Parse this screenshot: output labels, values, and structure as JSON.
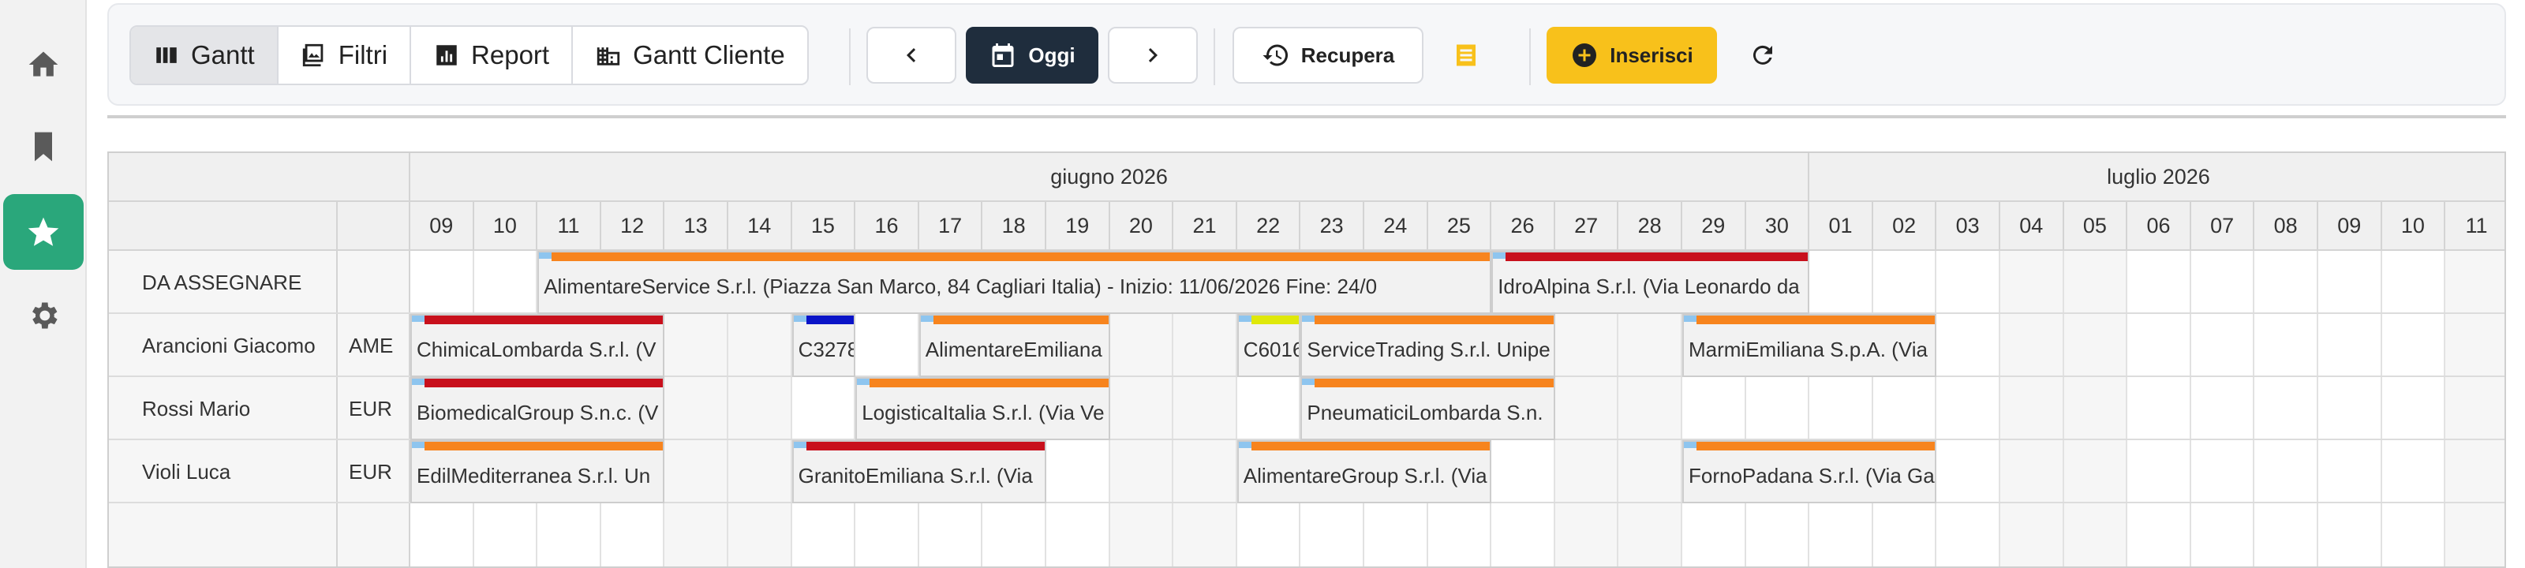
{
  "rail": {
    "items": [
      {
        "icon": "home-icon",
        "active": false
      },
      {
        "icon": "bookmark-icon",
        "active": false
      },
      {
        "icon": "star-icon",
        "active": true
      },
      {
        "icon": "gear-icon",
        "active": false
      }
    ]
  },
  "toolbar": {
    "views": [
      {
        "label": "Gantt",
        "icon": "columns-icon",
        "active": true
      },
      {
        "label": "Filtri",
        "icon": "image-filter-icon",
        "active": false
      },
      {
        "label": "Report",
        "icon": "chart-icon",
        "active": false
      },
      {
        "label": "Gantt Cliente",
        "icon": "building-icon",
        "active": false
      }
    ],
    "today_label": "Oggi",
    "recover_label": "Recupera",
    "insert_label": "Inserisci"
  },
  "colors": {
    "accent_green": "#2aa77b",
    "today_bg": "#1f2d3d",
    "insert_bg": "#f8c11b",
    "orange": "#f7841e",
    "red": "#c8101c",
    "blue": "#0a14c8",
    "yellow": "#dfe80a"
  },
  "gantt": {
    "months": [
      "giugno 2026",
      "luglio 2026"
    ],
    "days": [
      "09",
      "10",
      "11",
      "12",
      "13",
      "14",
      "15",
      "16",
      "17",
      "18",
      "19",
      "20",
      "21",
      "22",
      "23",
      "24",
      "25",
      "26",
      "27",
      "28",
      "29",
      "30",
      "01",
      "02",
      "03",
      "04",
      "05",
      "06",
      "07",
      "08",
      "09",
      "10",
      "11"
    ],
    "weekend_days": [
      4,
      5,
      11,
      12,
      18,
      19,
      25,
      26,
      32
    ],
    "rows": [
      {
        "name": "DA ASSEGNARE",
        "code": ""
      },
      {
        "name": "Arancioni Giacomo",
        "code": "AME"
      },
      {
        "name": "Rossi Mario",
        "code": "EUR"
      },
      {
        "name": "Violi Luca",
        "code": "EUR"
      }
    ],
    "bars": [
      {
        "row": 0,
        "start": 2,
        "end": 16,
        "color": "orange",
        "label": "AlimentareService S.r.l. (Piazza San Marco, 84 Cagliari Italia) - Inizio: 11/06/2026 Fine: 24/0"
      },
      {
        "row": 0,
        "start": 17,
        "end": 21,
        "color": "red",
        "label": "IdroAlpina S.r.l. (Via Leonardo da"
      },
      {
        "row": 1,
        "start": 0,
        "end": 3,
        "color": "red",
        "label": "ChimicaLombarda S.r.l. (V"
      },
      {
        "row": 1,
        "start": 6,
        "end": 6,
        "color": "blue",
        "label": "C3278"
      },
      {
        "row": 1,
        "start": 8,
        "end": 10,
        "color": "orange",
        "label": "AlimentareEmiliana"
      },
      {
        "row": 1,
        "start": 13,
        "end": 13,
        "color": "yellow",
        "label": "C6016"
      },
      {
        "row": 1,
        "start": 14,
        "end": 17,
        "color": "orange",
        "label": "ServiceTrading S.r.l. Unipe"
      },
      {
        "row": 1,
        "start": 20,
        "end": 23,
        "color": "orange",
        "label": "MarmiEmiliana S.p.A. (Via"
      },
      {
        "row": 2,
        "start": 0,
        "end": 3,
        "color": "red",
        "label": "BiomedicalGroup S.n.c. (V"
      },
      {
        "row": 2,
        "start": 7,
        "end": 10,
        "color": "orange",
        "label": "LogisticaItalia S.r.l. (Via Ve"
      },
      {
        "row": 2,
        "start": 14,
        "end": 17,
        "color": "orange",
        "label": "PneumaticiLombarda S.n."
      },
      {
        "row": 3,
        "start": 0,
        "end": 3,
        "color": "orange",
        "label": "EdilMediterranea S.r.l. Un"
      },
      {
        "row": 3,
        "start": 6,
        "end": 9,
        "color": "red",
        "label": "GranitoEmiliana S.r.l. (Via"
      },
      {
        "row": 3,
        "start": 13,
        "end": 16,
        "color": "orange",
        "label": "AlimentareGroup S.r.l. (Via"
      },
      {
        "row": 3,
        "start": 20,
        "end": 23,
        "color": "orange",
        "label": "FornoPadana S.r.l. (Via Ga"
      }
    ]
  }
}
